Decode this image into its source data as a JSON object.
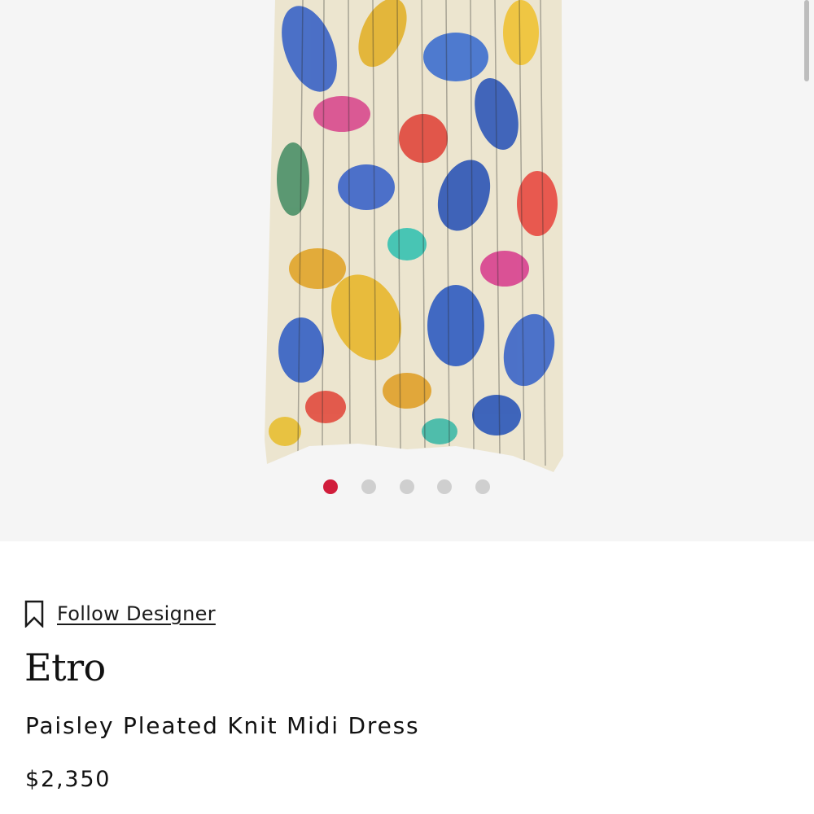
{
  "gallery": {
    "image_alt": "Paisley Pleated Knit Midi Dress",
    "dot_count": 5,
    "active_index": 0,
    "colors": {
      "active_dot": "#d11d3b",
      "inactive_dot": "#cfcfcf",
      "background": "#f5f5f5"
    }
  },
  "follow": {
    "icon": "bookmark-icon",
    "label": "Follow Designer"
  },
  "product": {
    "designer": "Etro",
    "name": "Paisley Pleated Knit Midi Dress",
    "price": "$2,350"
  }
}
